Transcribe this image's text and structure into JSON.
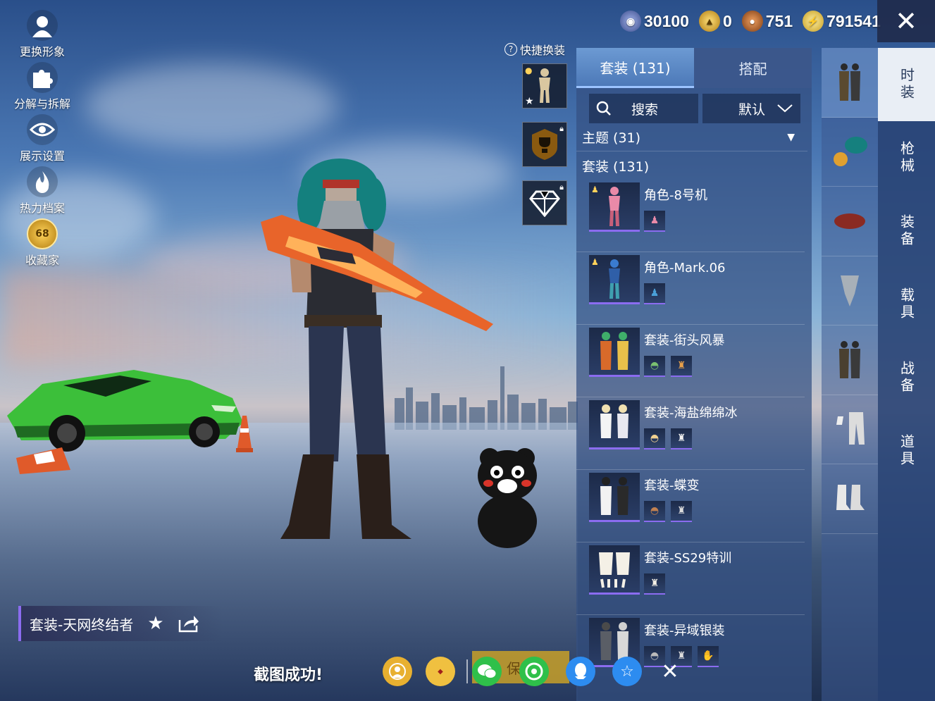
{
  "left_menu": [
    {
      "label": "更换形象",
      "icon": "user-icon"
    },
    {
      "label": "分解与拆解",
      "icon": "puzzle-icon"
    },
    {
      "label": "展示设置",
      "icon": "eye-icon"
    },
    {
      "label": "热力档案",
      "icon": "flame-icon"
    },
    {
      "label": "收藏家",
      "icon": "collector-badge-icon",
      "badge": "68"
    }
  ],
  "currency": [
    {
      "icon": "silver-coin-icon",
      "value": "30100",
      "color": "#5a6fb8"
    },
    {
      "icon": "gold-token-icon",
      "value": "0",
      "color": "#d9a51c"
    },
    {
      "icon": "bronze-coin-icon",
      "value": "751",
      "color": "#b8662a"
    },
    {
      "icon": "lightning-coin-icon",
      "value": "791541",
      "color": "#e8c64a"
    }
  ],
  "quick_change": {
    "label": "快捷换装",
    "help": "?"
  },
  "panel": {
    "tabs": [
      {
        "label": "套装 (131)",
        "active": true
      },
      {
        "label": "搭配",
        "active": false
      }
    ],
    "search_placeholder": "搜索",
    "sort_label": "默认",
    "filter_label": "主题 (31)",
    "section_title": "套装 (131)",
    "items": [
      {
        "title": "角色-8号机",
        "parts": [
          "person-icon"
        ]
      },
      {
        "title": "角色-Mark.06",
        "parts": [
          "person-icon"
        ]
      },
      {
        "title": "套装-街头风暴",
        "parts": [
          "helmet-icon",
          "outfit-icon"
        ]
      },
      {
        "title": "套装-海盐绵绵冰",
        "parts": [
          "hat-icon",
          "outfit-icon"
        ]
      },
      {
        "title": "套装-蝶变",
        "parts": [
          "helmet-icon",
          "outfit-icon"
        ]
      },
      {
        "title": "套装-SS29特训",
        "parts": [
          "outfit-icon"
        ]
      },
      {
        "title": "套装-异域银装",
        "parts": [
          "hat-icon",
          "outfit-icon",
          "glove-icon"
        ]
      }
    ]
  },
  "side_nav": [
    {
      "label": "时装",
      "active": true
    },
    {
      "label": "枪械",
      "active": false
    },
    {
      "label": "装备",
      "active": false
    },
    {
      "label": "载具",
      "active": false
    },
    {
      "label": "战备",
      "active": false
    },
    {
      "label": "道具",
      "active": false
    }
  ],
  "outfit_bar": {
    "name": "套装-天网终结者"
  },
  "share": {
    "message": "截图成功!",
    "save_label": "保存",
    "icons": [
      "avatar-share-icon",
      "game-logo-icon",
      "wechat-icon",
      "moments-icon",
      "qq-icon",
      "qzone-icon",
      "close-icon"
    ]
  }
}
